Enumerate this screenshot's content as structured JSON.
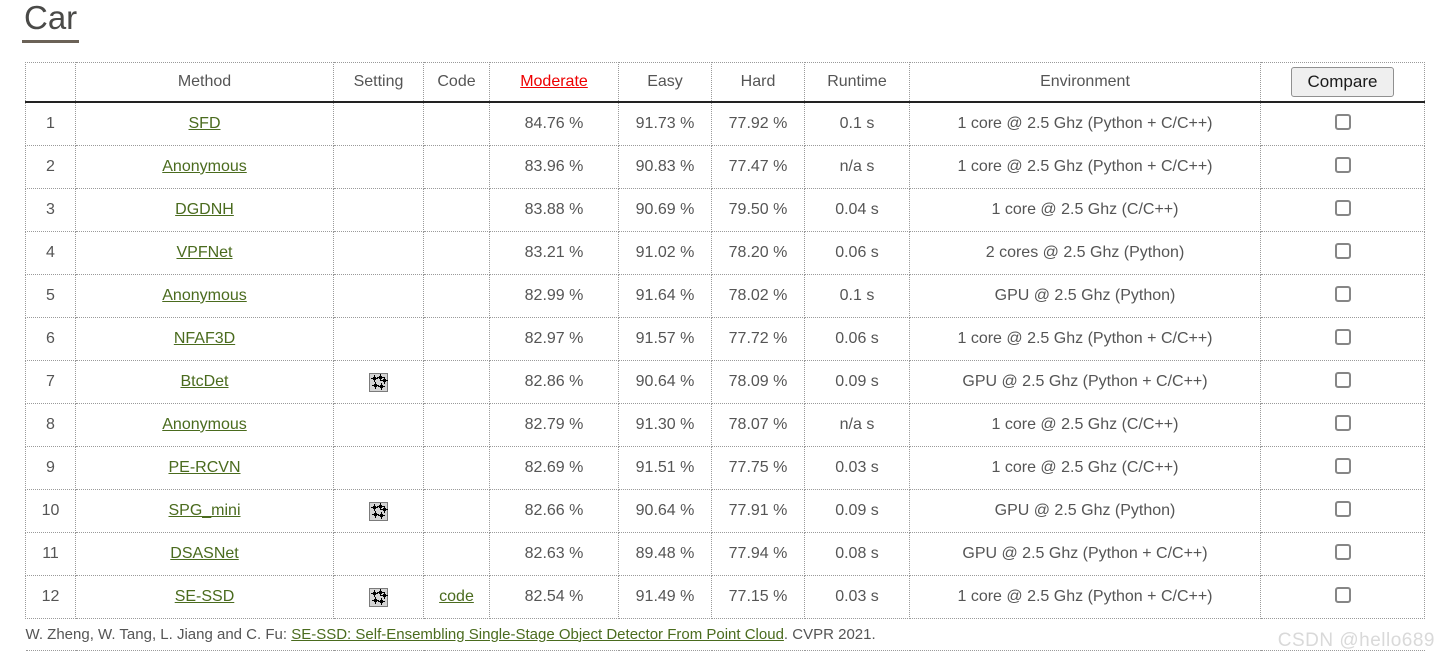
{
  "page": {
    "title": "Car",
    "watermark": "CSDN @hello689"
  },
  "table": {
    "headers": {
      "rank": "",
      "method": "Method",
      "setting": "Setting",
      "code": "Code",
      "moderate": "Moderate",
      "easy": "Easy",
      "hard": "Hard",
      "runtime": "Runtime",
      "environment": "Environment",
      "compare_button": "Compare"
    },
    "sorted_column": "moderate",
    "sorted_color": "#ee0000",
    "link_color": "#4a6b1e",
    "rows": [
      {
        "rank": "1",
        "method": "SFD",
        "setting_icon": "",
        "code": "",
        "moderate": "84.76 %",
        "easy": "91.73 %",
        "hard": "77.92 %",
        "runtime": "0.1 s",
        "environment": "1 core @ 2.5 Ghz (Python + C/C++)",
        "moderate_bold": true,
        "easy_bold": true,
        "hard_bold": false
      },
      {
        "rank": "2",
        "method": "Anonymous",
        "setting_icon": "",
        "code": "",
        "moderate": "83.96 %",
        "easy": "90.83 %",
        "hard": "77.47 %",
        "runtime": "n/a s",
        "environment": "1 core @ 2.5 Ghz (Python + C/C++)",
        "moderate_bold": false,
        "easy_bold": false,
        "hard_bold": false
      },
      {
        "rank": "3",
        "method": "DGDNH",
        "setting_icon": "",
        "code": "",
        "moderate": "83.88 %",
        "easy": "90.69 %",
        "hard": "79.50 %",
        "runtime": "0.04 s",
        "environment": "1 core @ 2.5 Ghz (C/C++)",
        "moderate_bold": false,
        "easy_bold": false,
        "hard_bold": true
      },
      {
        "rank": "4",
        "method": "VPFNet",
        "setting_icon": "",
        "code": "",
        "moderate": "83.21 %",
        "easy": "91.02 %",
        "hard": "78.20 %",
        "runtime": "0.06 s",
        "environment": "2 cores @ 2.5 Ghz (Python)",
        "moderate_bold": false,
        "easy_bold": false,
        "hard_bold": false
      },
      {
        "rank": "5",
        "method": "Anonymous",
        "setting_icon": "",
        "code": "",
        "moderate": "82.99 %",
        "easy": "91.64 %",
        "hard": "78.02 %",
        "runtime": "0.1 s",
        "environment": "GPU @ 2.5 Ghz (Python)",
        "moderate_bold": false,
        "easy_bold": false,
        "hard_bold": false
      },
      {
        "rank": "6",
        "method": "NFAF3D",
        "setting_icon": "",
        "code": "",
        "moderate": "82.97 %",
        "easy": "91.57 %",
        "hard": "77.72 %",
        "runtime": "0.06 s",
        "environment": "1 core @ 2.5 Ghz (Python + C/C++)",
        "moderate_bold": false,
        "easy_bold": false,
        "hard_bold": false
      },
      {
        "rank": "7",
        "method": "BtcDet",
        "setting_icon": "laser-icon",
        "code": "",
        "moderate": "82.86 %",
        "easy": "90.64 %",
        "hard": "78.09 %",
        "runtime": "0.09 s",
        "environment": "GPU @ 2.5 Ghz (Python + C/C++)",
        "moderate_bold": false,
        "easy_bold": false,
        "hard_bold": false
      },
      {
        "rank": "8",
        "method": "Anonymous",
        "setting_icon": "",
        "code": "",
        "moderate": "82.79 %",
        "easy": "91.30 %",
        "hard": "78.07 %",
        "runtime": "n/a s",
        "environment": "1 core @ 2.5 Ghz (C/C++)",
        "moderate_bold": false,
        "easy_bold": false,
        "hard_bold": false
      },
      {
        "rank": "9",
        "method": "PE-RCVN",
        "setting_icon": "",
        "code": "",
        "moderate": "82.69 %",
        "easy": "91.51 %",
        "hard": "77.75 %",
        "runtime": "0.03 s",
        "environment": "1 core @ 2.5 Ghz (C/C++)",
        "moderate_bold": false,
        "easy_bold": false,
        "hard_bold": false
      },
      {
        "rank": "10",
        "method": "SPG_mini",
        "setting_icon": "laser-icon",
        "code": "",
        "moderate": "82.66 %",
        "easy": "90.64 %",
        "hard": "77.91 %",
        "runtime": "0.09 s",
        "environment": "GPU @ 2.5 Ghz (Python)",
        "moderate_bold": false,
        "easy_bold": false,
        "hard_bold": false
      },
      {
        "rank": "11",
        "method": "DSASNet",
        "setting_icon": "",
        "code": "",
        "moderate": "82.63 %",
        "easy": "89.48 %",
        "hard": "77.94 %",
        "runtime": "0.08 s",
        "environment": "GPU @ 2.5 Ghz (Python + C/C++)",
        "moderate_bold": false,
        "easy_bold": false,
        "hard_bold": false
      },
      {
        "rank": "12",
        "method": "SE-SSD",
        "setting_icon": "laser-icon",
        "code": "code",
        "moderate": "82.54 %",
        "easy": "91.49 %",
        "hard": "77.15 %",
        "runtime": "0.03 s",
        "environment": "1 core @ 2.5 Ghz (Python + C/C++)",
        "moderate_bold": false,
        "easy_bold": false,
        "hard_bold": false
      }
    ],
    "citation": {
      "authors": "W. Zheng, W. Tang, L. Jiang and C. Fu: ",
      "paper_title": "SE-SSD: Self-Ensembling Single-Stage Object Detector From Point Cloud",
      "venue": ". CVPR 2021."
    }
  }
}
